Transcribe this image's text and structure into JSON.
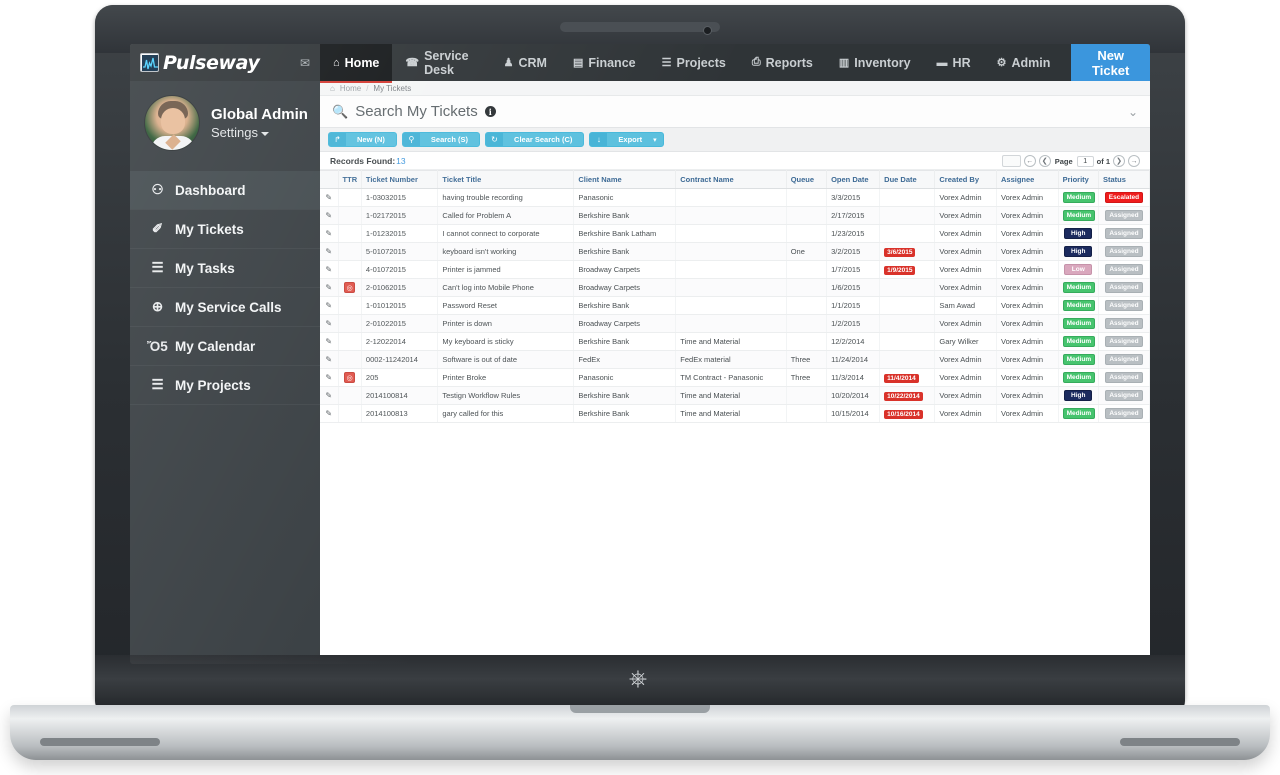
{
  "brand": {
    "name": "Pulseway",
    "mail_icon": "envelope-icon"
  },
  "profile": {
    "name": "Global Admin",
    "settings_label": "Settings"
  },
  "sidebar": {
    "items": [
      {
        "label": "Dashboard",
        "icon": "dashboard-icon",
        "active": true
      },
      {
        "label": "My Tickets",
        "icon": "ticket-icon",
        "active": false
      },
      {
        "label": "My Tasks",
        "icon": "tasks-icon",
        "active": false
      },
      {
        "label": "My Service Calls",
        "icon": "lifebuoy-icon",
        "active": false
      },
      {
        "label": "My Calendar",
        "icon": "calendar-icon",
        "active": false
      },
      {
        "label": "My Projects",
        "icon": "projects-icon",
        "active": false
      }
    ]
  },
  "topnav": {
    "items": [
      {
        "label": "Home",
        "icon": "home-icon",
        "active": true
      },
      {
        "label": "Service Desk",
        "icon": "headset-icon",
        "active": false
      },
      {
        "label": "CRM",
        "icon": "people-icon",
        "active": false
      },
      {
        "label": "Finance",
        "icon": "money-icon",
        "active": false
      },
      {
        "label": "Projects",
        "icon": "projects-icon",
        "active": false
      },
      {
        "label": "Reports",
        "icon": "print-icon",
        "active": false
      },
      {
        "label": "Inventory",
        "icon": "book-icon",
        "active": false
      },
      {
        "label": "HR",
        "icon": "briefcase-icon",
        "active": false
      },
      {
        "label": "Admin",
        "icon": "gear-icon",
        "active": false
      }
    ],
    "new_ticket_label": "New Ticket",
    "accent_color": "#3b96dd",
    "active_underline_color": "#d33a32"
  },
  "breadcrumb": {
    "home": "Home",
    "separator": "/",
    "current": "My Tickets"
  },
  "search": {
    "title": "Search My Tickets",
    "magnifier_icon": "search-icon",
    "info_icon": "info-icon",
    "collapse_icon": "chevron-down-icon"
  },
  "toolbar": {
    "buttons": [
      {
        "label": "New (N)",
        "icon": "new-icon",
        "caret": false
      },
      {
        "label": "Search (S)",
        "icon": "search-icon",
        "caret": false
      },
      {
        "label": "Clear Search (C)",
        "icon": "refresh-icon",
        "caret": false
      },
      {
        "label": "Export",
        "icon": "export-icon",
        "caret": true
      }
    ],
    "button_color": "#5bc0de"
  },
  "records": {
    "label": "Records Found:",
    "count": "13"
  },
  "pager": {
    "page_label": "Page",
    "page_value": "1",
    "of_label": "of 1",
    "first_icon": "first-page-icon",
    "prev_icon": "prev-page-icon",
    "next_icon": "next-page-icon",
    "last_icon": "last-page-icon"
  },
  "table": {
    "headers": [
      "",
      "TTR",
      "Ticket Number",
      "Ticket Title",
      "Client Name",
      "Contract Name",
      "Queue",
      "Open Date",
      "Due Date",
      "Created By",
      "Assignee",
      "Priority",
      "Status"
    ],
    "rows": [
      {
        "ttr": false,
        "number": "1-03032015",
        "title": "having trouble recording",
        "client": "Panasonic",
        "contract": "",
        "queue": "",
        "open": "3/3/2015",
        "due": "",
        "created_by": "Vorex Admin",
        "assignee": "Vorex Admin",
        "priority": "Medium",
        "status": "Escalated"
      },
      {
        "ttr": false,
        "number": "1-02172015",
        "title": "Called for Problem A",
        "client": "Berkshire Bank",
        "contract": "",
        "queue": "",
        "open": "2/17/2015",
        "due": "",
        "created_by": "Vorex Admin",
        "assignee": "Vorex Admin",
        "priority": "Medium",
        "status": "Assigned"
      },
      {
        "ttr": false,
        "number": "1-01232015",
        "title": "I cannot connect to corporate",
        "client": "Berkshire Bank Latham",
        "contract": "",
        "queue": "",
        "open": "1/23/2015",
        "due": "",
        "created_by": "Vorex Admin",
        "assignee": "Vorex Admin",
        "priority": "High",
        "status": "Assigned"
      },
      {
        "ttr": false,
        "number": "5-01072015",
        "title": "keyboard isn't working",
        "client": "Berkshire Bank",
        "contract": "",
        "queue": "One",
        "open": "3/2/2015",
        "due": "3/6/2015",
        "created_by": "Vorex Admin",
        "assignee": "Vorex Admin",
        "priority": "High",
        "status": "Assigned"
      },
      {
        "ttr": false,
        "number": "4-01072015",
        "title": "Printer is jammed",
        "client": "Broadway Carpets",
        "contract": "",
        "queue": "",
        "open": "1/7/2015",
        "due": "1/9/2015",
        "created_by": "Vorex Admin",
        "assignee": "Vorex Admin",
        "priority": "Low",
        "status": "Assigned"
      },
      {
        "ttr": true,
        "number": "2-01062015",
        "title": "Can't log into Mobile Phone",
        "client": "Broadway Carpets",
        "contract": "",
        "queue": "",
        "open": "1/6/2015",
        "due": "",
        "created_by": "Vorex Admin",
        "assignee": "Vorex Admin",
        "priority": "Medium",
        "status": "Assigned"
      },
      {
        "ttr": false,
        "number": "1-01012015",
        "title": "Password Reset",
        "client": "Berkshire Bank",
        "contract": "",
        "queue": "",
        "open": "1/1/2015",
        "due": "",
        "created_by": "Sam Awad",
        "assignee": "Vorex Admin",
        "priority": "Medium",
        "status": "Assigned"
      },
      {
        "ttr": false,
        "number": "2-01022015",
        "title": "Printer is down",
        "client": "Broadway Carpets",
        "contract": "",
        "queue": "",
        "open": "1/2/2015",
        "due": "",
        "created_by": "Vorex Admin",
        "assignee": "Vorex Admin",
        "priority": "Medium",
        "status": "Assigned"
      },
      {
        "ttr": false,
        "number": "2-12022014",
        "title": "My keyboard is sticky",
        "client": "Berkshire Bank",
        "contract": "Time and Material",
        "queue": "",
        "open": "12/2/2014",
        "due": "",
        "created_by": "Gary Wilker",
        "assignee": "Vorex Admin",
        "priority": "Medium",
        "status": "Assigned"
      },
      {
        "ttr": false,
        "number": "0002-11242014",
        "title": "Software is out of date",
        "client": "FedEx",
        "contract": "FedEx material",
        "queue": "Three",
        "open": "11/24/2014",
        "due": "",
        "created_by": "Vorex Admin",
        "assignee": "Vorex Admin",
        "priority": "Medium",
        "status": "Assigned"
      },
      {
        "ttr": true,
        "number": "205",
        "title": "Printer Broke",
        "client": "Panasonic",
        "contract": "TM Contract - Panasonic",
        "queue": "Three",
        "open": "11/3/2014",
        "due": "11/4/2014",
        "created_by": "Vorex Admin",
        "assignee": "Vorex Admin",
        "priority": "Medium",
        "status": "Assigned"
      },
      {
        "ttr": false,
        "number": "2014100814",
        "title": "Testign Workflow Rules",
        "client": "Berkshire Bank",
        "contract": "Time and Material",
        "queue": "",
        "open": "10/20/2014",
        "due": "10/22/2014",
        "created_by": "Vorex Admin",
        "assignee": "Vorex Admin",
        "priority": "High",
        "status": "Assigned"
      },
      {
        "ttr": false,
        "number": "2014100813",
        "title": "gary called for this",
        "client": "Berkshire Bank",
        "contract": "Time and Material",
        "queue": "",
        "open": "10/15/2014",
        "due": "10/16/2014",
        "created_by": "Vorex Admin",
        "assignee": "Vorex Admin",
        "priority": "Medium",
        "status": "Assigned"
      }
    ]
  },
  "device": {
    "power_icon": "power-icon"
  }
}
